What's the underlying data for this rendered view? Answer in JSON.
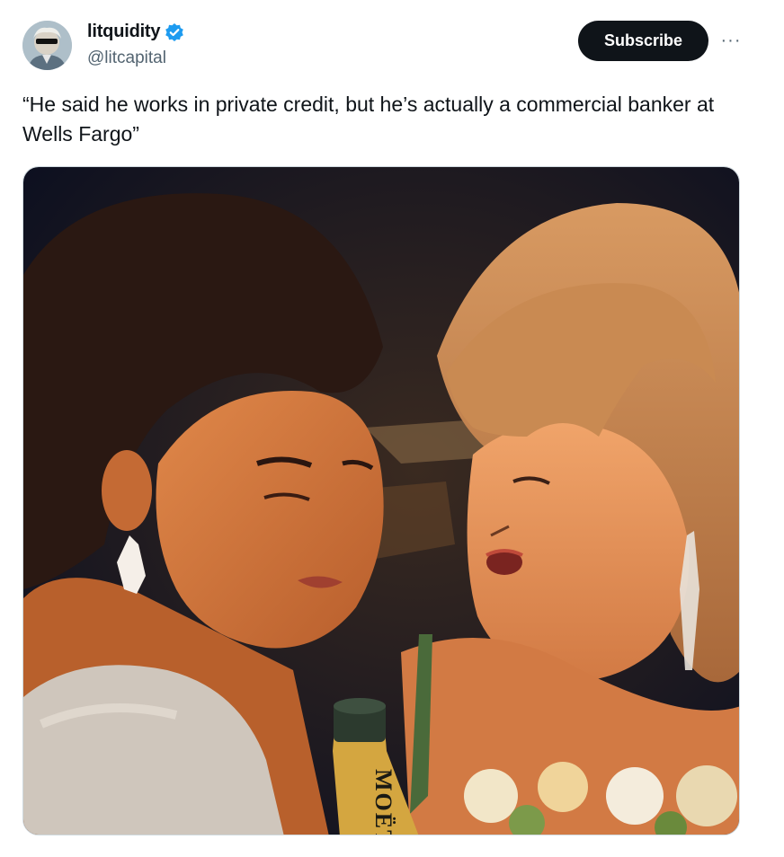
{
  "author": {
    "display_name": "litquidity",
    "handle": "@litcapital",
    "verified": true,
    "verified_badge_color": "#1d9bf0",
    "avatar_icon": "avatar-sunglasses-man"
  },
  "actions": {
    "subscribe_label": "Subscribe",
    "more_icon": "more-dots-icon",
    "more_glyph": "···"
  },
  "tweet": {
    "text": "“He said he works in private credit, but he’s actually a commercial banker at Wells Fargo”"
  },
  "media": {
    "bottle_label": "MOËT"
  },
  "colors": {
    "subscribe_bg": "#0f1419",
    "handle_color": "#536471",
    "text_color": "#0f1419"
  }
}
